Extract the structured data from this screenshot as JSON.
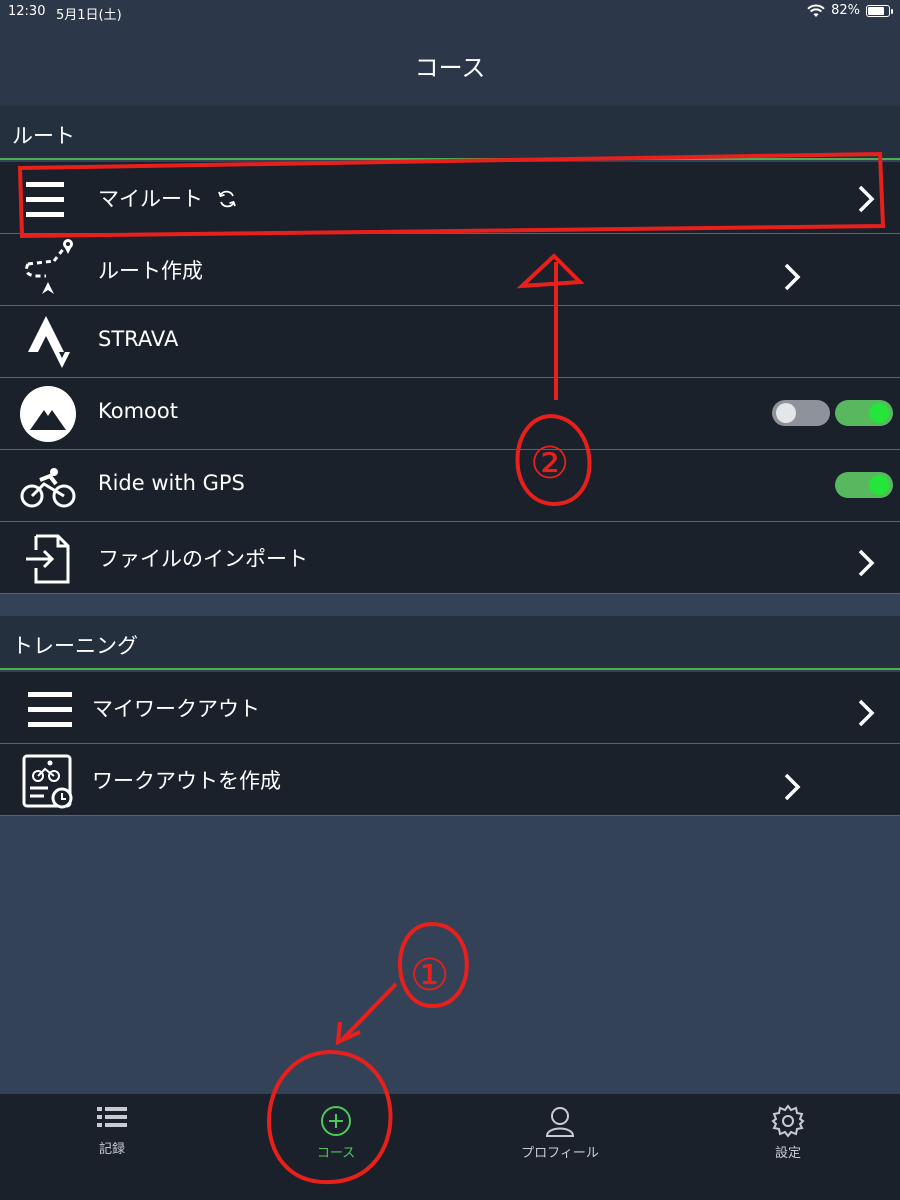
{
  "status_bar": {
    "time": "12:30",
    "date": "5月1日(土)",
    "battery": "82%",
    "battery_level": 0.82
  },
  "nav": {
    "title": "コース"
  },
  "sections": {
    "routes": {
      "header": "ルート",
      "items": [
        {
          "label": "マイルート",
          "icon": "list-icon"
        },
        {
          "label": "ルート作成",
          "icon": "route-create-icon"
        },
        {
          "label": "STRAVA",
          "icon": "strava-icon"
        },
        {
          "label": "Komoot",
          "icon": "komoot-icon"
        },
        {
          "label": "Ride with GPS",
          "icon": "cyclist-icon"
        },
        {
          "label": "ファイルのインポート",
          "icon": "file-import-icon"
        }
      ]
    },
    "training": {
      "header": "トレーニング",
      "items": [
        {
          "label": "マイワークアウト",
          "icon": "list-icon"
        },
        {
          "label": "ワークアウトを作成",
          "icon": "workout-create-icon"
        }
      ]
    }
  },
  "tabs": [
    {
      "label": "記録",
      "icon": "list-bullets-icon"
    },
    {
      "label": "コース",
      "icon": "plus-circle-icon",
      "active": true
    },
    {
      "label": "プロフィール",
      "icon": "user-icon"
    },
    {
      "label": "設定",
      "icon": "gear-icon"
    }
  ],
  "annotations": {
    "circle_one": "①",
    "circle_two": "②",
    "color": "#e8201c"
  }
}
